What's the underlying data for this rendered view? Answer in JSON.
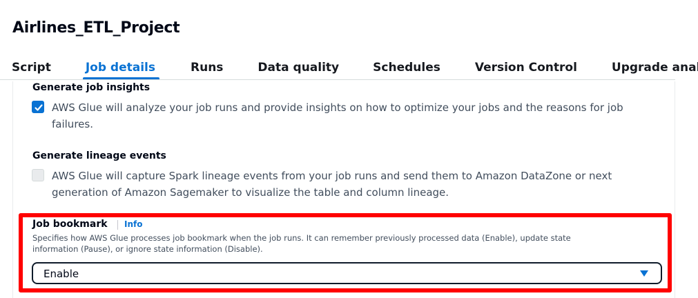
{
  "page": {
    "title": "Airlines_ETL_Project"
  },
  "tabs": [
    {
      "label": "Script",
      "active": false
    },
    {
      "label": "Job details",
      "active": true
    },
    {
      "label": "Runs",
      "active": false
    },
    {
      "label": "Data quality",
      "active": false
    },
    {
      "label": "Schedules",
      "active": false
    },
    {
      "label": "Version Control",
      "active": false
    },
    {
      "label": "Upgrade anal",
      "active": false
    }
  ],
  "job_insights": {
    "title": "Generate job insights",
    "checked": true,
    "description_line1": "AWS Glue will analyze your job runs and provide insights on how to optimize your jobs and the reasons for job",
    "description_line2": "failures."
  },
  "lineage_events": {
    "title": "Generate lineage events",
    "checked": false,
    "disabled": true,
    "description_line1": "AWS Glue will capture Spark lineage events from your job runs and send them to Amazon DataZone or next",
    "description_line2": "generation of Amazon Sagemaker to visualize the table and column lineage."
  },
  "job_bookmark": {
    "label": "Job bookmark",
    "info_link": "Info",
    "description_line1": "Specifies how AWS Glue processes job bookmark when the job runs. It can remember previously processed data (Enable), update state",
    "description_line2": "information (Pause), or ignore state information (Disable).",
    "selected_value": "Enable"
  },
  "colors": {
    "accent": "#0972d3",
    "highlight": "#ff0000"
  }
}
